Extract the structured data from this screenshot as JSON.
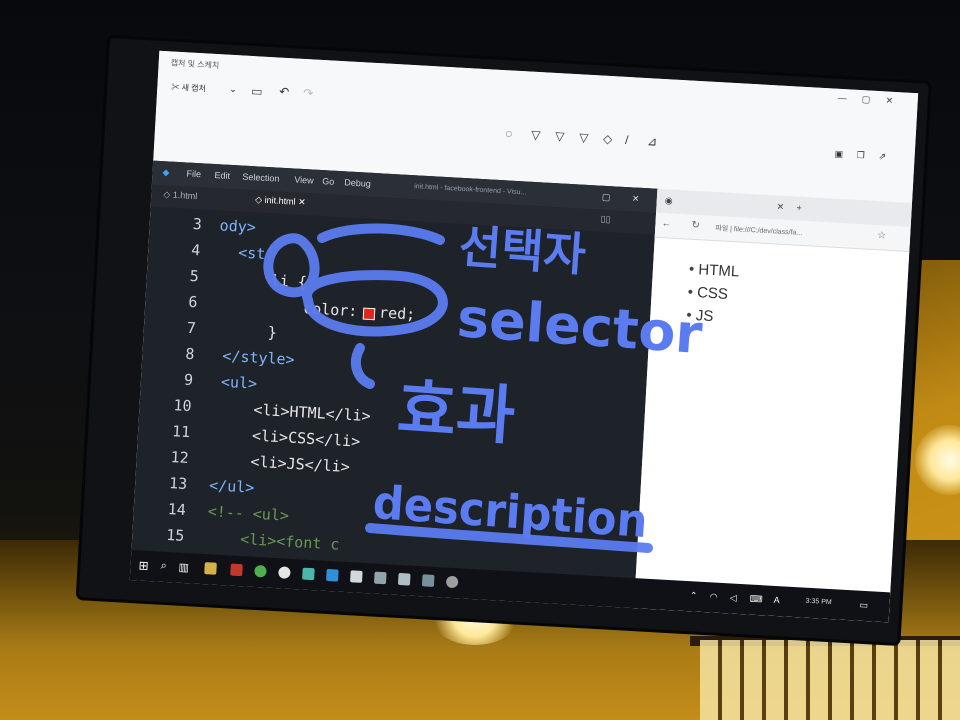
{
  "sketch_app": {
    "title": "캡처 및 스케치",
    "new_label": "새 캡처"
  },
  "vscode": {
    "menu": [
      "File",
      "Edit",
      "Selection",
      "View",
      "Go",
      "Debug"
    ],
    "window_title": "init.html - facebook-frontend - Visu...",
    "tabs": [
      "1.html",
      "init.html"
    ],
    "line_numbers": [
      "3",
      "4",
      "5",
      "6",
      "7",
      "8",
      "9",
      "10",
      "11",
      "12",
      "13",
      "14",
      "15"
    ],
    "code_lines": {
      "l3": "ody>",
      "l4": "<st",
      "l5": "li {",
      "l6_prop": "color:",
      "l6_value": "red;",
      "l7": "}",
      "l8": "</style>",
      "l9": "<ul>",
      "l10": "<li>HTML</li>",
      "l11": "<li>CSS</li>",
      "l12": "<li>JS</li>",
      "l13": "</ul>",
      "l14": "<!-- <ul>",
      "l15": "<li><font c"
    }
  },
  "browser": {
    "address": "파일 | file:///C:/dev/class/fa...",
    "list_items": [
      "HTML",
      "CSS",
      "JS"
    ]
  },
  "annotations": {
    "korean_selector": "선택자",
    "english_selector": "selector",
    "korean_effect": "효과",
    "english_effect": "description"
  },
  "taskbar": {
    "clock": "3:35 PM"
  },
  "colors": {
    "ink": "#5b7cf0",
    "color_swatch": "#e0271e"
  }
}
